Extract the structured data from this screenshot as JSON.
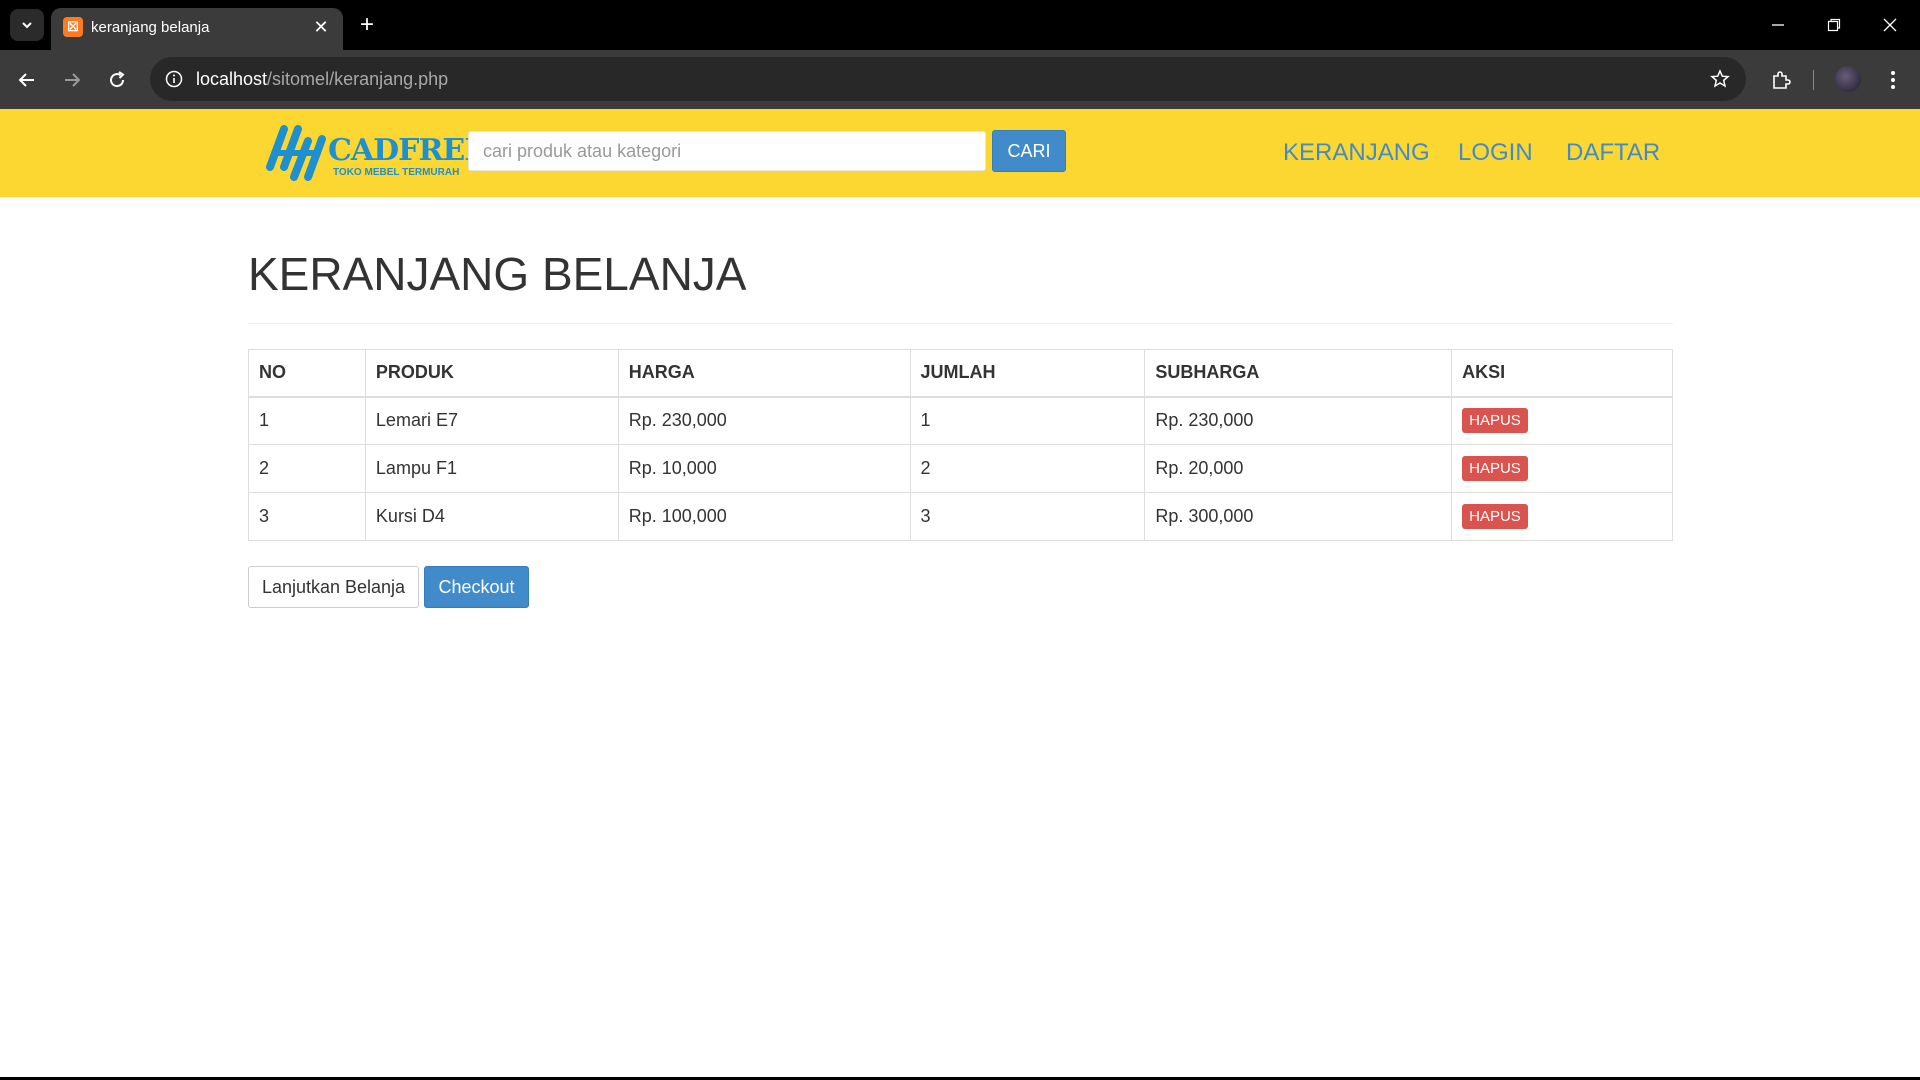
{
  "browser": {
    "tab_title": "keranjang belanja",
    "url_host": "localhost",
    "url_path": "/sitomel/keranjang.php",
    "favicon_icon": "xampp-icon"
  },
  "header": {
    "logo_name": "CADFREE",
    "logo_tagline": "TOKO MEBEL TERMURAH",
    "search_placeholder": "cari produk atau kategori",
    "search_value": "",
    "search_button": "CARI",
    "nav": [
      {
        "label": "KERANJANG"
      },
      {
        "label": "LOGIN"
      },
      {
        "label": "DAFTAR"
      }
    ],
    "colors": {
      "bar": "#fcd731",
      "link": "#428bca",
      "logo": "#1e8fcf"
    }
  },
  "main": {
    "title": "KERANJANG BELANJA",
    "columns": [
      "NO",
      "PRODUK",
      "HARGA",
      "JUMLAH",
      "SUBHARGA",
      "AKSI"
    ],
    "rows": [
      {
        "no": "1",
        "produk": "Lemari E7",
        "harga": "Rp. 230,000",
        "jumlah": "1",
        "subharga": "Rp. 230,000",
        "aksi": "HAPUS"
      },
      {
        "no": "2",
        "produk": "Lampu F1",
        "harga": "Rp. 10,000",
        "jumlah": "2",
        "subharga": "Rp. 20,000",
        "aksi": "HAPUS"
      },
      {
        "no": "3",
        "produk": "Kursi D4",
        "harga": "Rp. 100,000",
        "jumlah": "3",
        "subharga": "Rp. 300,000",
        "aksi": "HAPUS"
      }
    ],
    "continue_button": "Lanjutkan Belanja",
    "checkout_button": "Checkout",
    "colors": {
      "danger": "#d9534f",
      "primary": "#428bca"
    }
  }
}
